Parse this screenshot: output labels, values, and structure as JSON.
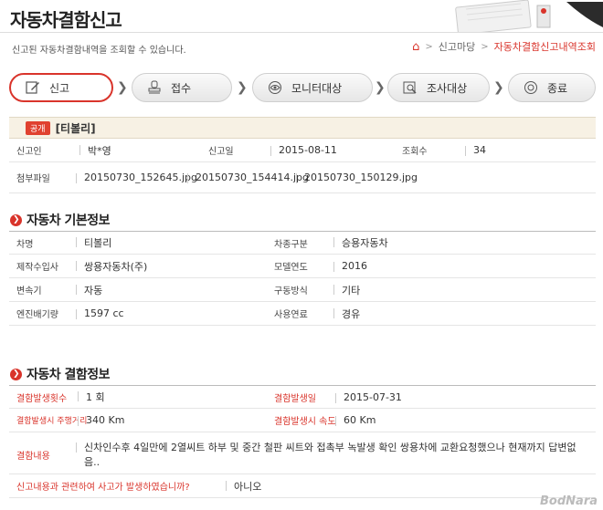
{
  "header": {
    "title": "자동차결함신고",
    "subtitle": "신고된 자동차결함내역을 조회할 수 있습니다.",
    "breadcrumb": [
      "신고마당",
      "자동차결함신고내역조회"
    ]
  },
  "steps": [
    {
      "label": "신고",
      "icon": "pencil-icon"
    },
    {
      "label": "접수",
      "icon": "stamp-icon"
    },
    {
      "label": "모니터대상",
      "icon": "monitor-icon"
    },
    {
      "label": "조사대상",
      "icon": "search-doc-icon"
    },
    {
      "label": "종료",
      "icon": "power-icon"
    }
  ],
  "post": {
    "badge": "공개",
    "title": "[티볼리]",
    "reporter_label": "신고인",
    "reporter": "박*영",
    "date_label": "신고일",
    "date": "2015-08-11",
    "views_label": "조회수",
    "views": "34",
    "attach_label": "첨부파일",
    "attachments": [
      "20150730_152645.jpg",
      "20150730_154414.jpg",
      "20150730_150129.jpg"
    ]
  },
  "basic": {
    "title": "자동차 기본정보",
    "rows": [
      [
        {
          "label": "차명",
          "value": "티볼리"
        },
        {
          "label": "차종구분",
          "value": "승용자동차"
        }
      ],
      [
        {
          "label": "제작수입사",
          "value": "쌍용자동차(주)"
        },
        {
          "label": "모델연도",
          "value": "2016"
        }
      ],
      [
        {
          "label": "변속기",
          "value": "자동"
        },
        {
          "label": "구동방식",
          "value": "기타"
        }
      ],
      [
        {
          "label": "엔진배기량",
          "value": "1597 cc"
        },
        {
          "label": "사용연료",
          "value": "경유"
        }
      ]
    ]
  },
  "defect": {
    "title": "자동차 결함정보",
    "rows": [
      [
        {
          "label": "결함발생횟수",
          "value": "1 회"
        },
        {
          "label": "결함발생일",
          "value": "2015-07-31"
        }
      ],
      [
        {
          "label": "결함발생시 주행거리",
          "value": "340 Km"
        },
        {
          "label": "결함발생시 속도",
          "value": "60 Km"
        }
      ]
    ],
    "content_label": "결함내용",
    "content": "신차인수후 4일만에 2열씨트 하부 및 중간 철판 씨트와 접촉부 녹발생 확인 쌍용차에 교환요청했으나 현재까지 답변없음..",
    "accident_label": "신고내용과 관련하여 사고가 발생하였습니까?",
    "accident": "아니오"
  },
  "watermark": "BodNara"
}
